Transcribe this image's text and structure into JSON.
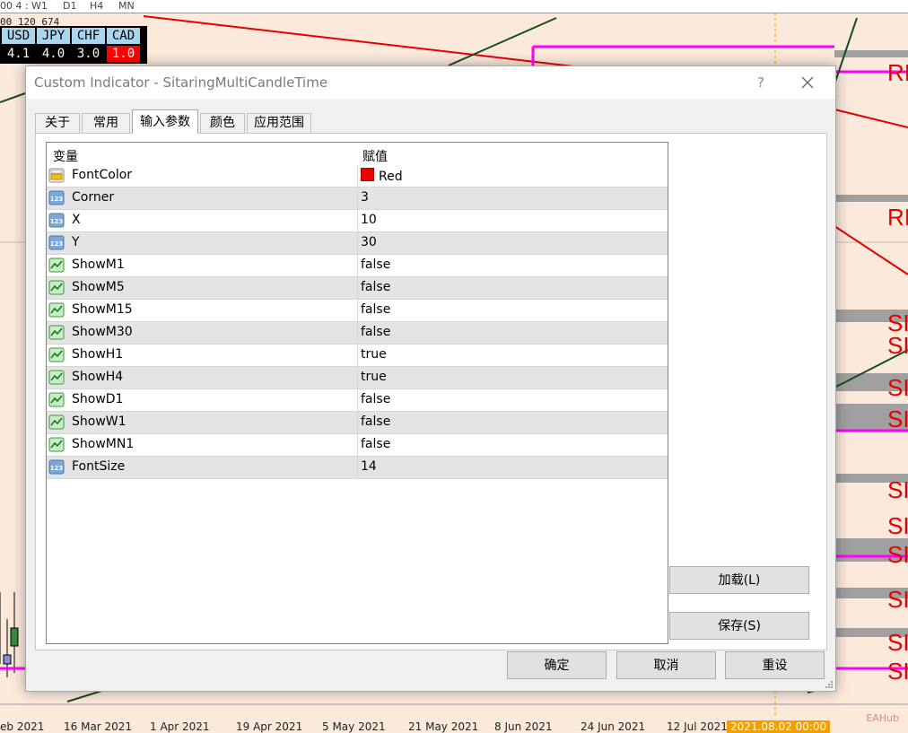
{
  "chart": {
    "top_strip": [
      "00 4  :",
      "W1",
      "D1",
      "H4",
      "MN"
    ],
    "price": "00 120 674",
    "currency_headers": [
      "USD",
      "JPY",
      "CHF",
      "CAD"
    ],
    "currency_values": [
      "4.1",
      "4.0",
      "3.0",
      "1.0"
    ],
    "dates": [
      "eb 2021",
      "16 Mar 2021",
      "1 Apr 2021",
      "19 Apr 2021",
      "5 May 2021",
      "21 May 2021",
      "8 Jun 2021",
      "24 Jun 2021",
      "12 Jul 2021"
    ],
    "current_date": "2021.08.02 00:00",
    "markers": [
      "RI",
      "RI",
      "SI",
      "SI",
      "SI",
      "SI",
      "SI",
      "SI",
      "SI",
      "SI",
      "SI",
      "SI"
    ],
    "watermark": "EAHub",
    "colors": {
      "background": "#fbe9dc",
      "magenta": "#ff00ff",
      "red": "#e60000",
      "green": "#1a4d1a"
    }
  },
  "dialog": {
    "title": "Custom Indicator - SitaringMultiCandleTime",
    "help": "?",
    "tabs": [
      {
        "label": "关于"
      },
      {
        "label": "常用"
      },
      {
        "label": "输入参数"
      },
      {
        "label": "颜色"
      },
      {
        "label": "应用范围"
      }
    ],
    "active_tab": "输入参数",
    "grid": {
      "header_variable": "变量",
      "header_value": "赋值",
      "rows": [
        {
          "name": "FontColor",
          "value": "Red",
          "icon": "color-icon"
        },
        {
          "name": "Corner",
          "value": "3",
          "icon": "integer-icon"
        },
        {
          "name": "X",
          "value": "10",
          "icon": "integer-icon"
        },
        {
          "name": "Y",
          "value": "30",
          "icon": "integer-icon"
        },
        {
          "name": "ShowM1",
          "value": "false",
          "icon": "bool-icon"
        },
        {
          "name": "ShowM5",
          "value": "false",
          "icon": "bool-icon"
        },
        {
          "name": "ShowM15",
          "value": "false",
          "icon": "bool-icon"
        },
        {
          "name": "ShowM30",
          "value": "false",
          "icon": "bool-icon"
        },
        {
          "name": "ShowH1",
          "value": "true",
          "icon": "bool-icon"
        },
        {
          "name": "ShowH4",
          "value": "true",
          "icon": "bool-icon"
        },
        {
          "name": "ShowD1",
          "value": "false",
          "icon": "bool-icon"
        },
        {
          "name": "ShowW1",
          "value": "false",
          "icon": "bool-icon"
        },
        {
          "name": "ShowMN1",
          "value": "false",
          "icon": "bool-icon"
        },
        {
          "name": "FontSize",
          "value": "14",
          "icon": "integer-icon"
        }
      ]
    },
    "buttons": {
      "load": "加载(L)",
      "save": "保存(S)",
      "ok": "确定",
      "cancel": "取消",
      "reset": "重设"
    }
  }
}
